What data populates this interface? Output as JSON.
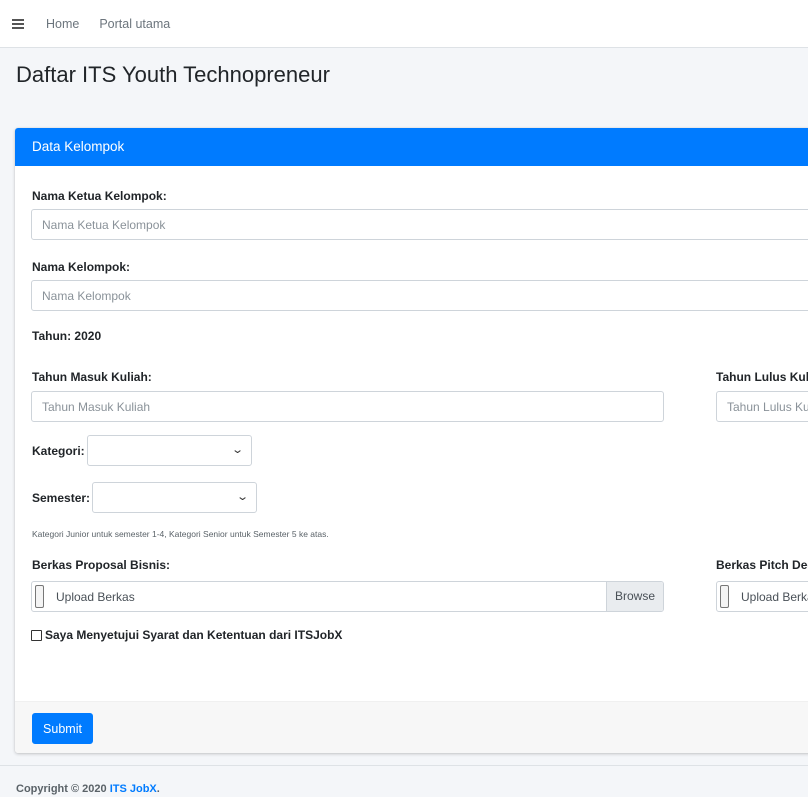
{
  "navbar": {
    "menu_icon": "hamburger-icon",
    "links": [
      "Home",
      "Portal utama"
    ]
  },
  "page": {
    "title": "Daftar ITS Youth Technopreneur"
  },
  "card": {
    "header": "Data Kelompok",
    "accent_color": "#007bff",
    "fields": {
      "ketua_label": "Nama Ketua Kelompok:",
      "ketua_placeholder": "Nama Ketua Kelompok",
      "kelompok_label": "Nama Kelompok:",
      "kelompok_placeholder": "Nama Kelompok",
      "tahun": "Tahun: 2020",
      "masuk_label": "Tahun Masuk Kuliah:",
      "masuk_placeholder": "Tahun Masuk Kuliah",
      "lulus_label": "Tahun Lulus Kuliah:",
      "lulus_placeholder": "Tahun Lulus Kuliah",
      "kategori_label": "Kategori:",
      "kategori_value": "",
      "semester_label": "Semester:",
      "semester_value": "",
      "hint": "Kategori Junior untuk semester 1-4, Kategori Senior untuk Semester 5 ke atas.",
      "proposal_label": "Berkas Proposal Bisnis:",
      "proposal_text": "Upload Berkas",
      "browse": "Browse",
      "pitch_label": "Berkas Pitch Deck:",
      "pitch_text": "Upload Berkas",
      "agree": "Saya Menyetujui Syarat dan Ketentuan dari ITSJobX"
    },
    "submit": "Submit"
  },
  "footer": {
    "copyright": "Copyright © 2020 ",
    "brand": "ITS JobX",
    "dot": "."
  }
}
